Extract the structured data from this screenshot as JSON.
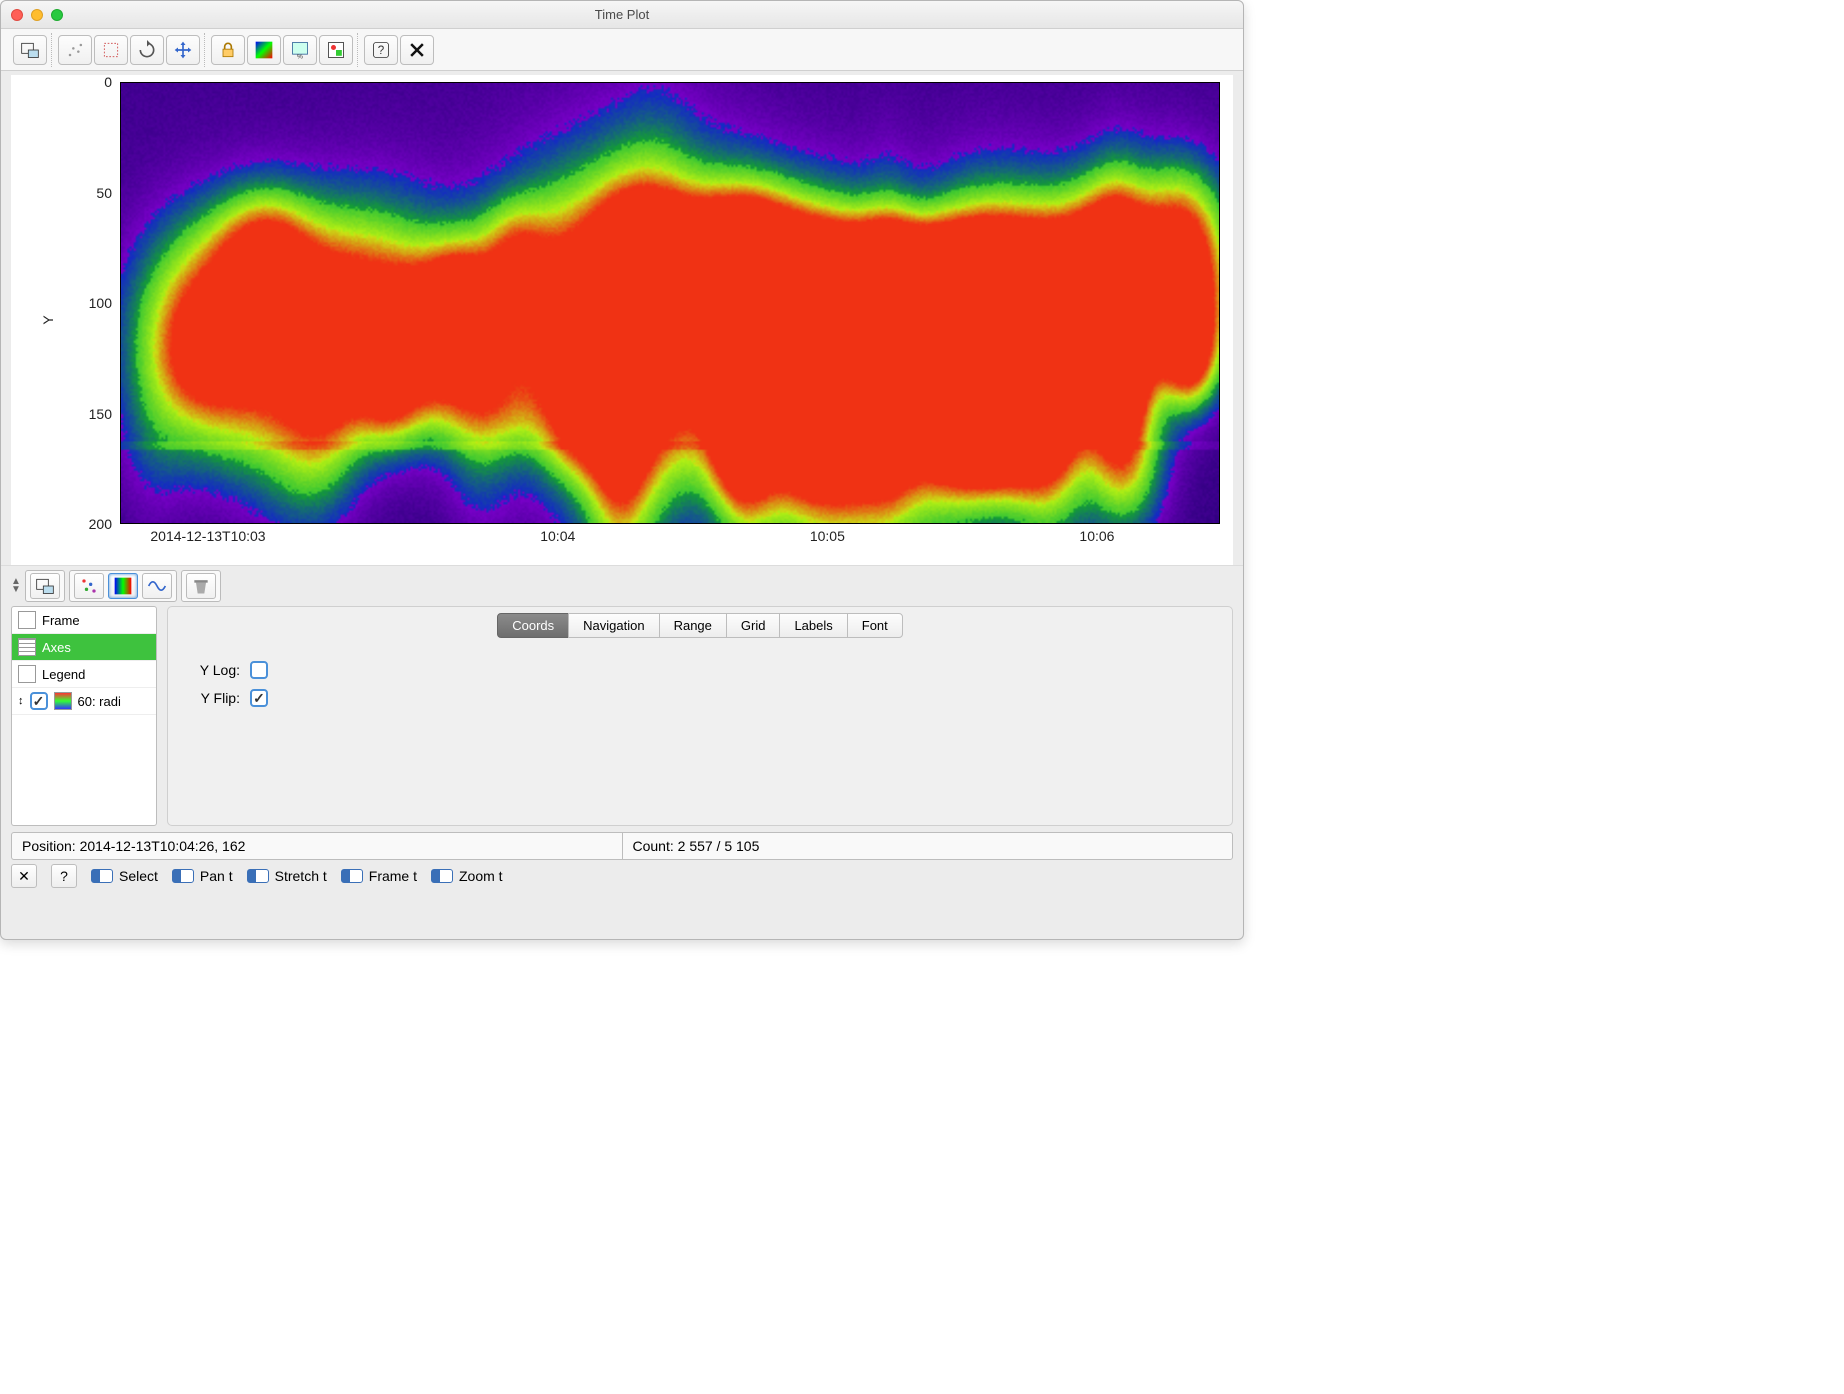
{
  "window": {
    "title": "Time Plot"
  },
  "chart_data": {
    "type": "heatmap",
    "title": "",
    "xlabel": "",
    "ylabel": "Y",
    "y_ticks": [
      "0",
      "50",
      "100",
      "150",
      "200"
    ],
    "ylim": [
      0,
      200
    ],
    "y_flipped": true,
    "x_ticks": [
      "2014-12-13T10:03",
      "10:04",
      "10:05",
      "10:06"
    ],
    "colormap": "rainbow",
    "note": "dense 2D time-series; pixel values not individually labeled"
  },
  "sidebar": {
    "items": [
      {
        "label": "Frame",
        "selected": false
      },
      {
        "label": "Axes",
        "selected": true
      },
      {
        "label": "Legend",
        "selected": false
      },
      {
        "label": "60: radi",
        "selected": false,
        "checkbox": true
      }
    ]
  },
  "tabs": {
    "items": [
      "Coords",
      "Navigation",
      "Range",
      "Grid",
      "Labels",
      "Font"
    ],
    "active": "Coords"
  },
  "coords_form": {
    "ylog_label": "Y Log:",
    "ylog_checked": false,
    "yflip_label": "Y Flip:",
    "yflip_checked": true
  },
  "status": {
    "position_label": "Position: 2014-12-13T10:04:26, 162",
    "count_label": "Count: 2 557 / 5 105"
  },
  "bottom_bar": {
    "close": "✕",
    "help": "?",
    "items": [
      "Select",
      "Pan t",
      "Stretch t",
      "Frame t",
      "Zoom t"
    ]
  }
}
